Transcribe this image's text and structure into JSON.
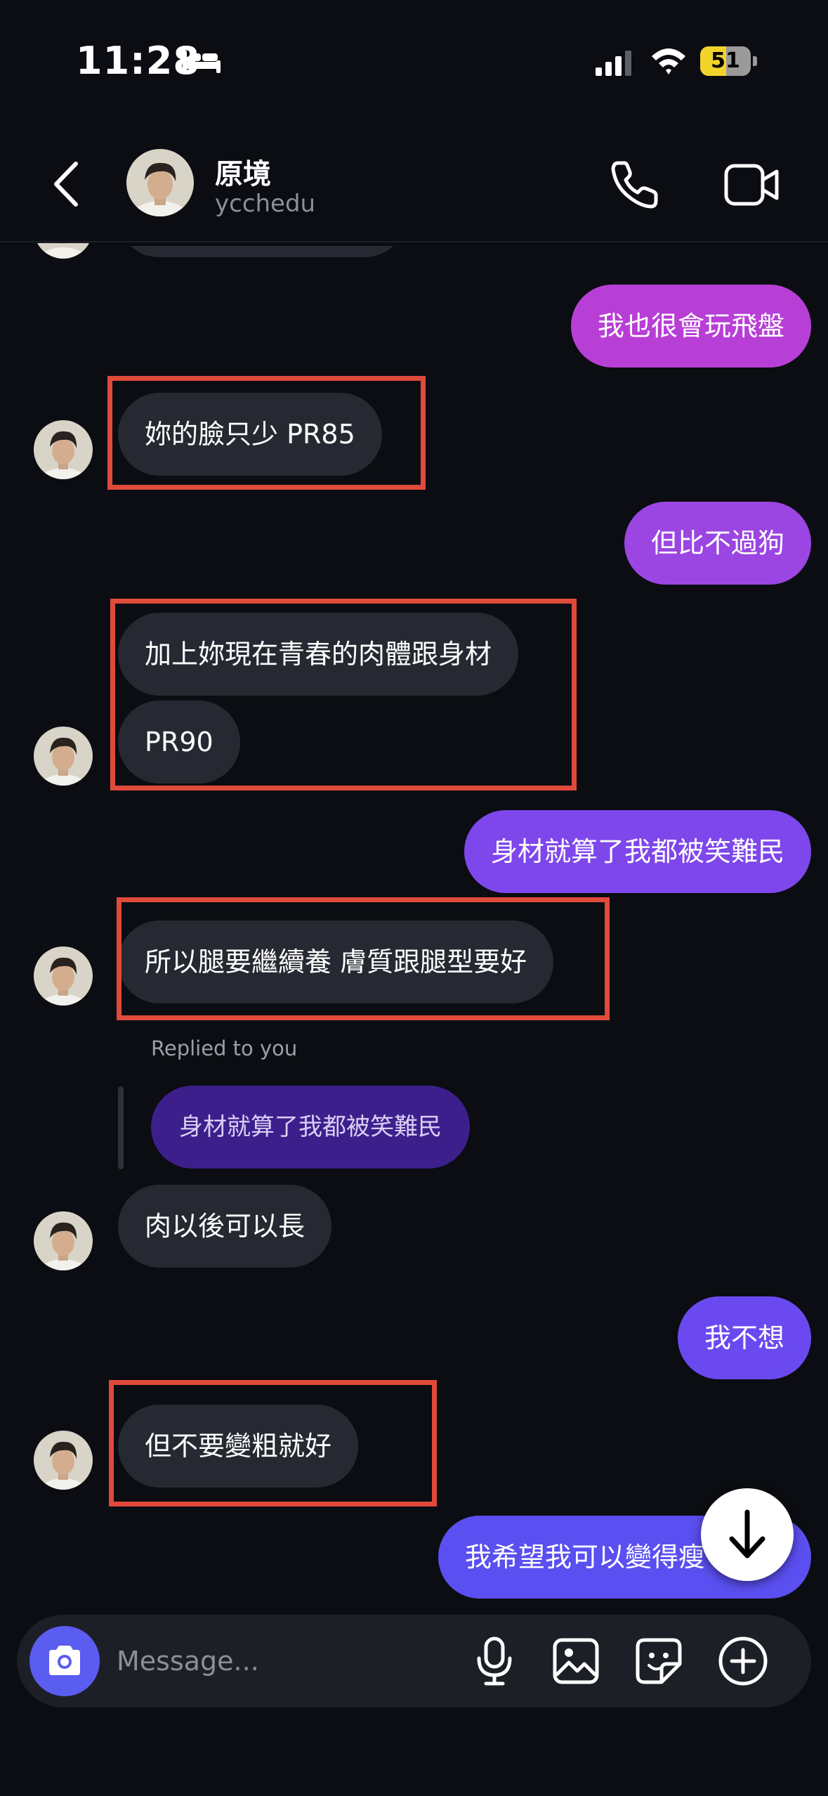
{
  "status_bar": {
    "time": "11:28",
    "battery_level": "51",
    "battery_fraction": 0.51
  },
  "header": {
    "name": "原境",
    "username": "ycchedu"
  },
  "messages": [
    {
      "from": "me",
      "text": "我也很會玩飛盤"
    },
    {
      "from": "them",
      "text": "妳的臉只少 PR85"
    },
    {
      "from": "me",
      "text": "但比不過狗"
    },
    {
      "from": "them",
      "text": "加上妳現在青春的肉體跟身材"
    },
    {
      "from": "them",
      "text": "PR90"
    },
    {
      "from": "me",
      "text": "身材就算了我都被笑難民"
    },
    {
      "from": "them",
      "text": "所以腿要繼續養 膚質跟腿型要好"
    },
    {
      "from": "them",
      "text": "肉以後可以長",
      "reply_label": "Replied to you",
      "reply_quote": "身材就算了我都被笑難民"
    },
    {
      "from": "me",
      "text": "我不想"
    },
    {
      "from": "them",
      "text": "但不要變粗就好"
    },
    {
      "from": "me",
      "text": "我希望我可以變得瘦"
    }
  ],
  "composer": {
    "placeholder": "Message..."
  },
  "colors": {
    "background": "#0b0d12",
    "incoming_bubble": "#262931",
    "highlight": "#e04a3b",
    "outgoing_gradient": [
      "#b83fd6",
      "#9b45e3",
      "#7e47ec",
      "#6a4af0",
      "#5a4ff0"
    ]
  }
}
